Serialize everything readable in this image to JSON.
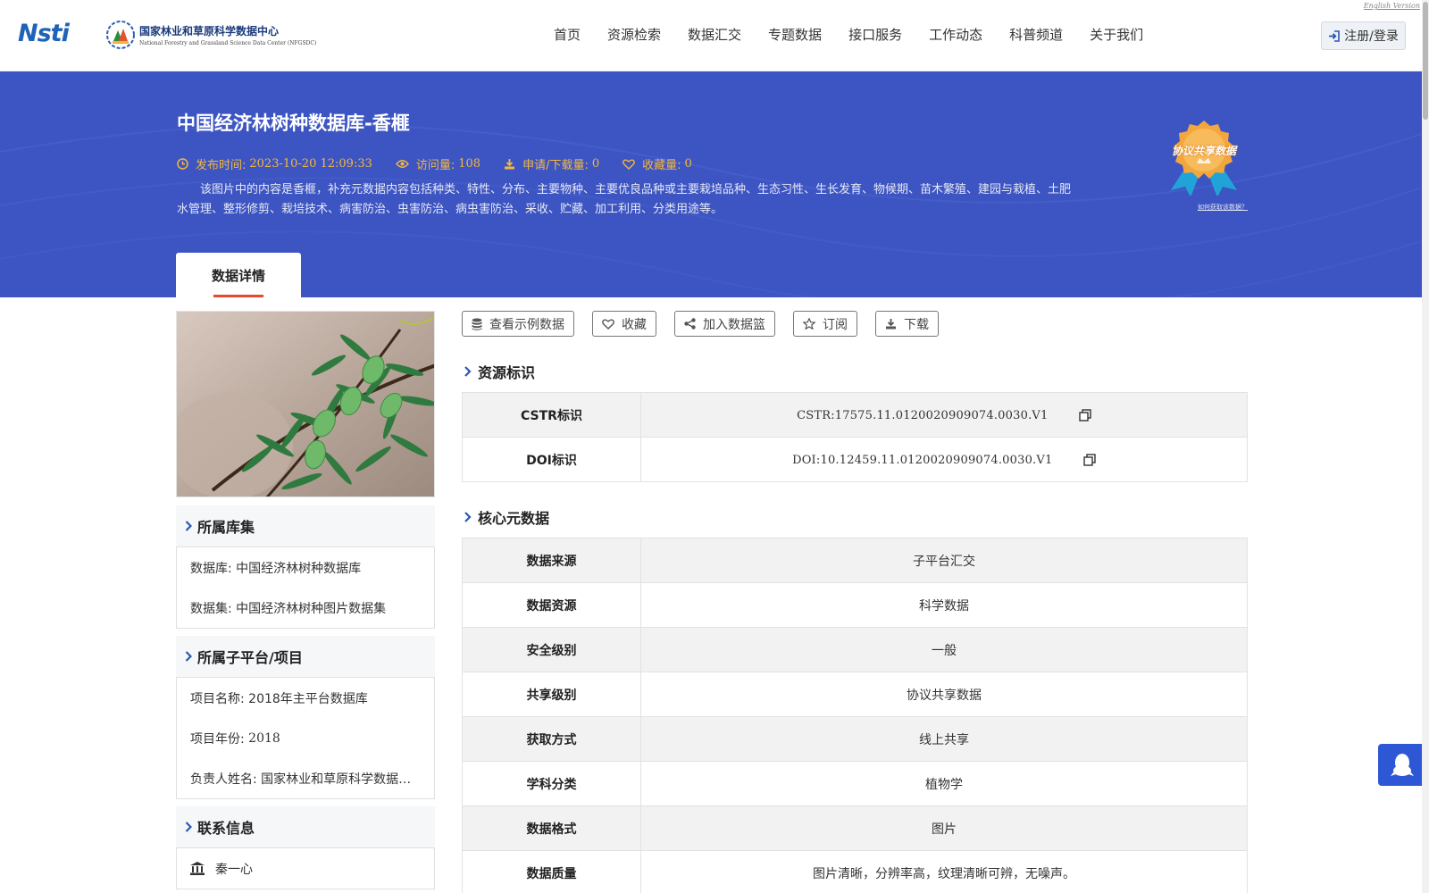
{
  "header": {
    "logo_text": "Nsti",
    "org_name_cn": "国家林业和草原科学数据中心",
    "org_name_en": "National Forestry and Grassland Science Data Center (NFGSDC)",
    "english_link": "English Version",
    "nav": [
      "首页",
      "资源检索",
      "数据汇交",
      "专题数据",
      "接口服务",
      "工作动态",
      "科普频道",
      "关于我们"
    ],
    "login_label": "注册/登录"
  },
  "banner": {
    "title": "中国经济林树种数据库-香榧",
    "meta": {
      "publish_label": "发布时间:",
      "publish_value": "2023-10-20 12:09:33",
      "views_label": "访问量:",
      "views_value": "108",
      "downloads_label": "申请/下载量:",
      "downloads_value": "0",
      "favorites_label": "收藏量:",
      "favorites_value": "0"
    },
    "description": "该图片中的内容是香榧，补充元数据内容包括种类、特性、分布、主要物种、主要优良品种或主要栽培品种、生态习性、生长发育、物候期、苗木繁殖、建园与栽植、土肥水管理、整形修剪、栽培技术、病害防治、虫害防治、病虫害防治、采收、贮藏、加工利用、分类用途等。",
    "badge_label": "协议共享数据",
    "badge_link": "如何获取该数据？",
    "tab_active": "数据详情"
  },
  "left": {
    "collection": {
      "title": "所属库集",
      "database_label": "数据库:",
      "database_value": "中国经济林树种数据库",
      "dataset_label": "数据集:",
      "dataset_value": "中国经济林树种图片数据集"
    },
    "project": {
      "title": "所属子平台/项目",
      "name_label": "项目名称:",
      "name_value": "2018年主平台数据库",
      "year_label": "项目年份:",
      "year_value": "2018",
      "owner_label": "负责人姓名:",
      "owner_value": "国家林业和草原科学数据中心"
    },
    "contact": {
      "title": "联系信息",
      "name": "秦一心"
    }
  },
  "right": {
    "actions": [
      "查看示例数据",
      "收藏",
      "加入数据篮",
      "订阅",
      "下载"
    ],
    "identity": {
      "title": "资源标识",
      "rows": [
        {
          "key": "CSTR标识",
          "value": "CSTR:17575.11.0120020909074.0030.V1"
        },
        {
          "key": "DOI标识",
          "value": "DOI:10.12459.11.0120020909074.0030.V1"
        }
      ]
    },
    "core": {
      "title": "核心元数据",
      "rows": [
        {
          "key": "数据来源",
          "value": "子平台汇交"
        },
        {
          "key": "数据资源",
          "value": "科学数据"
        },
        {
          "key": "安全级别",
          "value": "一般"
        },
        {
          "key": "共享级别",
          "value": "协议共享数据"
        },
        {
          "key": "获取方式",
          "value": "线上共享"
        },
        {
          "key": "学科分类",
          "value": "植物学"
        },
        {
          "key": "数据格式",
          "value": "图片"
        },
        {
          "key": "数据质量",
          "value": "图片清晰，分辨率高，纹理清晰可辨，无噪声。"
        }
      ]
    }
  },
  "colors": {
    "banner": "#3d55c2",
    "meta_accent": "#f4b73d",
    "tab_underline": "#e44a2e",
    "chat_button": "#2e57d6"
  }
}
